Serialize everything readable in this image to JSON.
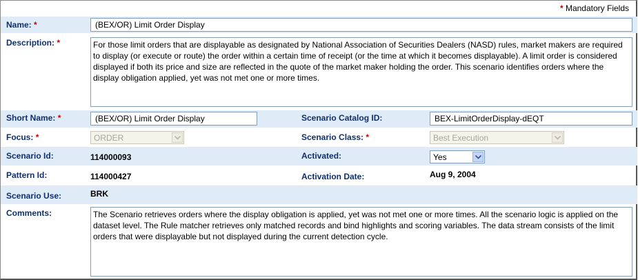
{
  "mandatory_note": {
    "star": "*",
    "text": "Mandatory Fields"
  },
  "name": {
    "label": "Name:",
    "required": "*",
    "value": "(BEX/OR) Limit Order Display"
  },
  "description": {
    "label": "Description:",
    "required": "*",
    "value": "For those limit orders that are displayable as designated by National Association of Securities Dealers (NASD) rules, market makers are required to display (or execute or route) the order within a certain time of receipt (or the time at which it becomes displayable). A limit order is considered displayed if both its price and size are reflected in the quote of the market maker holding the order. This scenario identifies orders where the display obligation applied, yet was not met one or more times."
  },
  "short_name": {
    "label": "Short Name:",
    "required": "*",
    "value": "(BEX/OR) Limit Order Display"
  },
  "scenario_catalog_id": {
    "label": "Scenario Catalog ID:",
    "value": "BEX-LimitOrderDisplay-dEQT"
  },
  "focus": {
    "label": "Focus:",
    "required": "*",
    "value": "ORDER"
  },
  "scenario_class": {
    "label": "Scenario Class:",
    "required": "*",
    "value": "Best Execution"
  },
  "scenario_id": {
    "label": "Scenario Id:",
    "value": "114000093"
  },
  "activated": {
    "label": "Activated:",
    "value": "Yes"
  },
  "pattern_id": {
    "label": "Pattern Id:",
    "value": "114000427"
  },
  "activation_date": {
    "label": "Activation Date:",
    "value": "Aug 9, 2004"
  },
  "scenario_use": {
    "label": "Scenario Use:",
    "value": "BRK"
  },
  "comments": {
    "label": "Comments:",
    "value": "The Scenario retrieves orders where the display obligation is applied, yet was not met one or more times. All the scenario logic is applied on the dataset level. The Rule matcher retrieves only matched records and bind highlights and scoring variables. The data stream consists of the limit orders that were displayable but not displayed during the current detection cycle."
  },
  "icons": {
    "dropdown": "chevron-down-icon"
  },
  "colors": {
    "label": "#10306b",
    "required": "#cc0000",
    "band": "#e0ebf8",
    "border": "#7f9db9"
  }
}
